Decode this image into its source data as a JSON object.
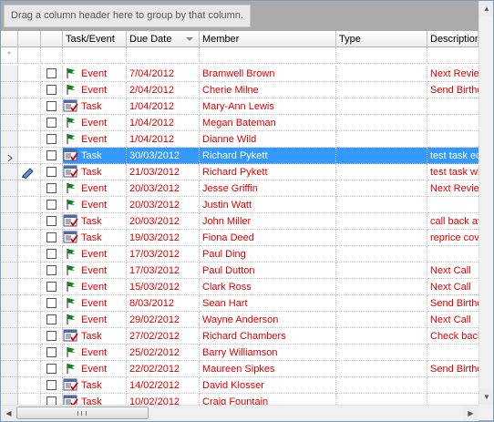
{
  "group_panel": {
    "hint": "Drag a column header here to group by that column."
  },
  "columns": {
    "task_event": "Task/Event",
    "due_date": "Due Date",
    "member": "Member",
    "type": "Type",
    "description": "Description"
  },
  "new_row_marker": "*",
  "rows": [
    {
      "kind": "Event",
      "due": "7/04/2012",
      "member": "Bramwell Brown",
      "type": "",
      "desc": "Next Review",
      "red": true
    },
    {
      "kind": "Event",
      "due": "2/04/2012",
      "member": "Cherie Milne",
      "type": "",
      "desc": "Send Birthday",
      "red": true
    },
    {
      "kind": "Task",
      "due": "1/04/2012",
      "member": "Mary-Ann Lewis",
      "type": "",
      "desc": "",
      "red": true
    },
    {
      "kind": "Event",
      "due": "1/04/2012",
      "member": "Megan Bateman",
      "type": "",
      "desc": "",
      "red": true
    },
    {
      "kind": "Event",
      "due": "1/04/2012",
      "member": "Dianne Wild",
      "type": "",
      "desc": "",
      "red": true
    },
    {
      "kind": "Task",
      "due": "30/03/2012",
      "member": "Richard Pykett",
      "type": "",
      "desc": "test task edit",
      "red": true,
      "selected": true
    },
    {
      "kind": "Task",
      "due": "21/03/2012",
      "member": "Richard Pykett",
      "type": "",
      "desc": "test task with",
      "red": true,
      "editing": true
    },
    {
      "kind": "Event",
      "due": "20/03/2012",
      "member": "Jesse Griffin",
      "type": "",
      "desc": "Next Review",
      "red": true
    },
    {
      "kind": "Event",
      "due": "20/03/2012",
      "member": "Justin Watt",
      "type": "",
      "desc": "",
      "red": true
    },
    {
      "kind": "Task",
      "due": "20/03/2012",
      "member": "John Miller",
      "type": "",
      "desc": "call back after",
      "red": true
    },
    {
      "kind": "Task",
      "due": "19/03/2012",
      "member": "Fiona Deed",
      "type": "",
      "desc": "reprice cover",
      "red": true
    },
    {
      "kind": "Event",
      "due": "17/03/2012",
      "member": "Paul Ding",
      "type": "",
      "desc": "",
      "red": true
    },
    {
      "kind": "Event",
      "due": "17/03/2012",
      "member": "Paul Dutton",
      "type": "",
      "desc": "Next Call",
      "red": true
    },
    {
      "kind": "Event",
      "due": "15/03/2012",
      "member": "Clark Ross",
      "type": "",
      "desc": "Next Call",
      "red": true
    },
    {
      "kind": "Event",
      "due": "8/03/2012",
      "member": "Sean Hart",
      "type": "",
      "desc": "Send Birthday",
      "red": true
    },
    {
      "kind": "Event",
      "due": "29/02/2012",
      "member": "Wayne Anderson",
      "type": "",
      "desc": "Next Call",
      "red": true
    },
    {
      "kind": "Task",
      "due": "27/02/2012",
      "member": "Richard Chambers",
      "type": "",
      "desc": "Check back",
      "red": true
    },
    {
      "kind": "Event",
      "due": "25/02/2012",
      "member": "Barry Williamson",
      "type": "",
      "desc": "",
      "red": true
    },
    {
      "kind": "Event",
      "due": "22/02/2012",
      "member": "Maureen Sipkes",
      "type": "",
      "desc": "Send Birthday",
      "red": true
    },
    {
      "kind": "Task",
      "due": "14/02/2012",
      "member": "David Klosser",
      "type": "",
      "desc": "",
      "red": true
    },
    {
      "kind": "Task",
      "due": "10/02/2012",
      "member": "Craig Fountain",
      "type": "",
      "desc": "",
      "red": true
    }
  ],
  "colors": {
    "row_text": "#e00000",
    "selection": "#3399ff",
    "flag": "#1a7f1a"
  }
}
